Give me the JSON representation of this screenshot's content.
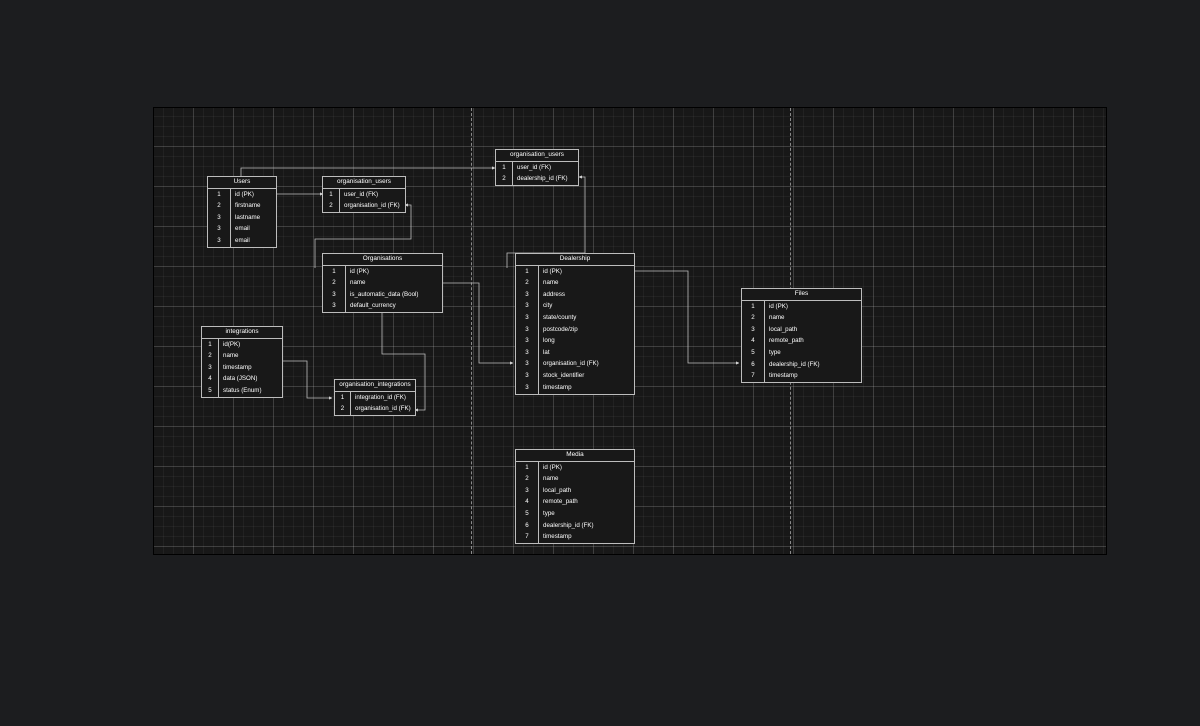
{
  "diagram": {
    "tables": [
      {
        "id": "users",
        "title": "Users",
        "rows": [
          {
            "n": "1",
            "field": "id (PK)"
          },
          {
            "n": "2",
            "field": "firstname"
          },
          {
            "n": "3",
            "field": "lastname"
          },
          {
            "n": "3",
            "field": "email"
          },
          {
            "n": "3",
            "field": "email"
          }
        ]
      },
      {
        "id": "organisation-users-1",
        "title": "organisation_users",
        "rows": [
          {
            "n": "1",
            "field": "user_id (FK)"
          },
          {
            "n": "2",
            "field": "organisation_id (FK)"
          }
        ]
      },
      {
        "id": "organisation-users-2",
        "title": "organisation_users",
        "rows": [
          {
            "n": "1",
            "field": "user_id (FK)"
          },
          {
            "n": "2",
            "field": "dealership_id (FK)"
          }
        ]
      },
      {
        "id": "organisations",
        "title": "Organisations",
        "rows": [
          {
            "n": "1",
            "field": "id (PK)"
          },
          {
            "n": "2",
            "field": "name"
          },
          {
            "n": "3",
            "field": "is_automatic_data (Bool)"
          },
          {
            "n": "3",
            "field": "default_currency"
          }
        ]
      },
      {
        "id": "dealership",
        "title": "Dealership",
        "rows": [
          {
            "n": "1",
            "field": "id (PK)"
          },
          {
            "n": "2",
            "field": "name"
          },
          {
            "n": "3",
            "field": "address"
          },
          {
            "n": "3",
            "field": "city"
          },
          {
            "n": "3",
            "field": "state/county"
          },
          {
            "n": "3",
            "field": "postcode/zip"
          },
          {
            "n": "3",
            "field": "long"
          },
          {
            "n": "3",
            "field": "lat"
          },
          {
            "n": "3",
            "field": "organisation_id (FK)"
          },
          {
            "n": "3",
            "field": "stock_identifier"
          },
          {
            "n": "3",
            "field": "timestamp"
          }
        ]
      },
      {
        "id": "files",
        "title": "Files",
        "rows": [
          {
            "n": "1",
            "field": "id (PK)"
          },
          {
            "n": "2",
            "field": "name"
          },
          {
            "n": "3",
            "field": "local_path"
          },
          {
            "n": "4",
            "field": "remote_path"
          },
          {
            "n": "5",
            "field": "type"
          },
          {
            "n": "6",
            "field": "dealership_id (FK)"
          },
          {
            "n": "7",
            "field": "timestamp"
          }
        ]
      },
      {
        "id": "integrations",
        "title": "integrations",
        "rows": [
          {
            "n": "1",
            "field": "id(PK)"
          },
          {
            "n": "2",
            "field": "name"
          },
          {
            "n": "3",
            "field": "timestamp"
          },
          {
            "n": "4",
            "field": "data (JSON)"
          },
          {
            "n": "5",
            "field": "status (Enum)"
          }
        ]
      },
      {
        "id": "organisation-integrations",
        "title": "organisation_integrations",
        "rows": [
          {
            "n": "1",
            "field": "integration_id (FK)"
          },
          {
            "n": "2",
            "field": "organisation_id (FK)"
          }
        ]
      },
      {
        "id": "media",
        "title": "Media",
        "rows": [
          {
            "n": "1",
            "field": "id (PK)"
          },
          {
            "n": "2",
            "field": "name"
          },
          {
            "n": "3",
            "field": "local_path"
          },
          {
            "n": "4",
            "field": "remote_path"
          },
          {
            "n": "5",
            "field": "type"
          },
          {
            "n": "6",
            "field": "dealership_id (FK)"
          },
          {
            "n": "7",
            "field": "timestamp"
          }
        ]
      }
    ]
  },
  "colors": {
    "canvas": "#181818",
    "background": "#1c1d1f",
    "line": "#bdbdbd",
    "text": "#ffffff"
  }
}
